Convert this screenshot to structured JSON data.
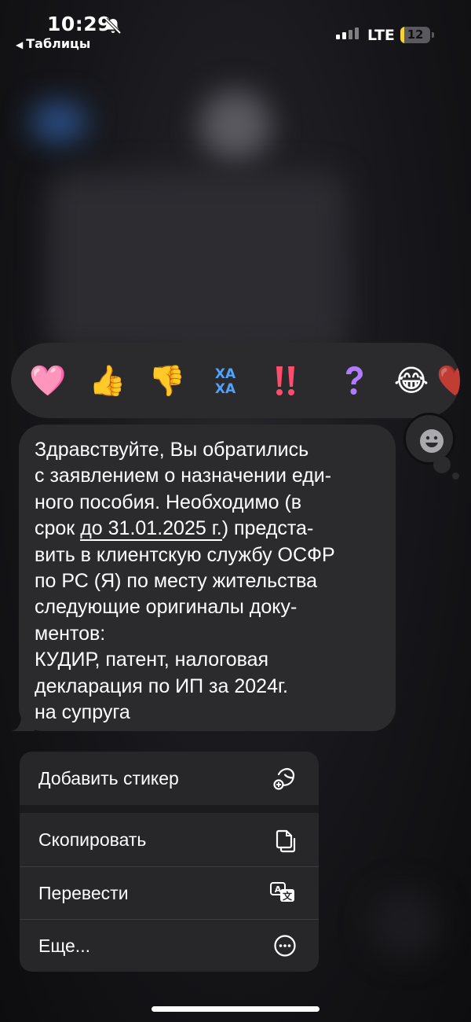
{
  "status_bar": {
    "time": "10:29",
    "back_label": "Таблицы",
    "network": "LTE",
    "battery": "12",
    "battery_level": 0.12
  },
  "reactions": [
    {
      "name": "heart",
      "glyph": "🩷"
    },
    {
      "name": "thumbs-up",
      "glyph": "👍"
    },
    {
      "name": "thumbs-down",
      "glyph": "👎"
    },
    {
      "name": "haha",
      "glyph": "🤣"
    },
    {
      "name": "exclamation",
      "glyph": "‼️"
    },
    {
      "name": "question",
      "glyph": "❔"
    },
    {
      "name": "laugh",
      "glyph": "😂"
    },
    {
      "name": "more-partial",
      "glyph": "❤️"
    }
  ],
  "message": {
    "lines": [
      "Здравствуйте, Вы обратились",
      "с заявлением о назначении еди-",
      "ного пособия. Необходимо (в",
      "срок ",
      "вить в клиентскую службу ОСФР",
      "по РС (Я) по месту жительства",
      "следующие оригиналы доку-",
      "ментов:",
      "КУДИР, патент, налоговая",
      "декларация по ИП за 2024г.",
      "на супруга"
    ],
    "deadline": "до 31.01.2025 г.",
    "deadline_after": ") предста-",
    "deadline_before": ""
  },
  "menu": {
    "add_sticker": "Добавить стикер",
    "copy": "Скопировать",
    "translate": "Перевести",
    "more": "Еще..."
  }
}
